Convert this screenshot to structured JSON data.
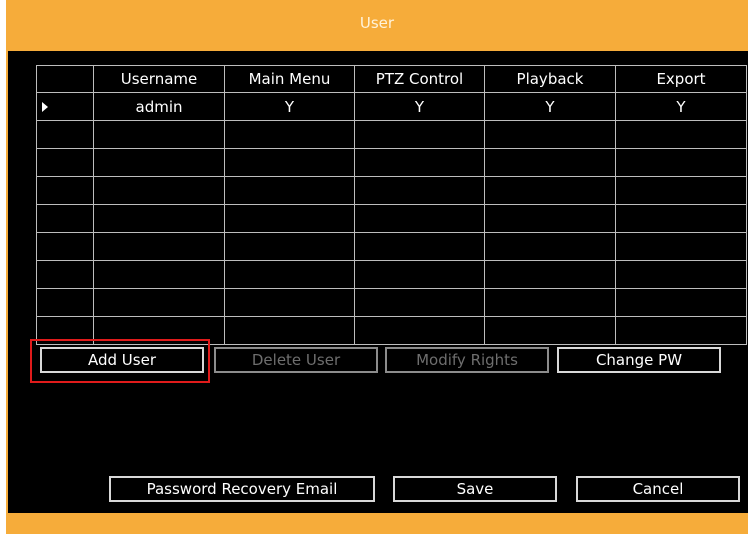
{
  "window": {
    "title": "User"
  },
  "table": {
    "headers": [
      "",
      "Username",
      "Main Menu",
      "PTZ Control",
      "Playback",
      "Export"
    ],
    "rows": [
      {
        "username": "admin",
        "main_menu": "Y",
        "ptz_control": "Y",
        "playback": "Y",
        "export": "Y"
      }
    ]
  },
  "buttons": {
    "add_user": "Add User",
    "delete_user": "Delete User",
    "modify_rights": "Modify Rights",
    "change_pw": "Change PW",
    "password_recovery_email": "Password Recovery Email",
    "save": "Save",
    "cancel": "Cancel"
  },
  "colors": {
    "frame": "#f6ac3a",
    "panel": "#000000",
    "highlight": "#e01b1b"
  }
}
